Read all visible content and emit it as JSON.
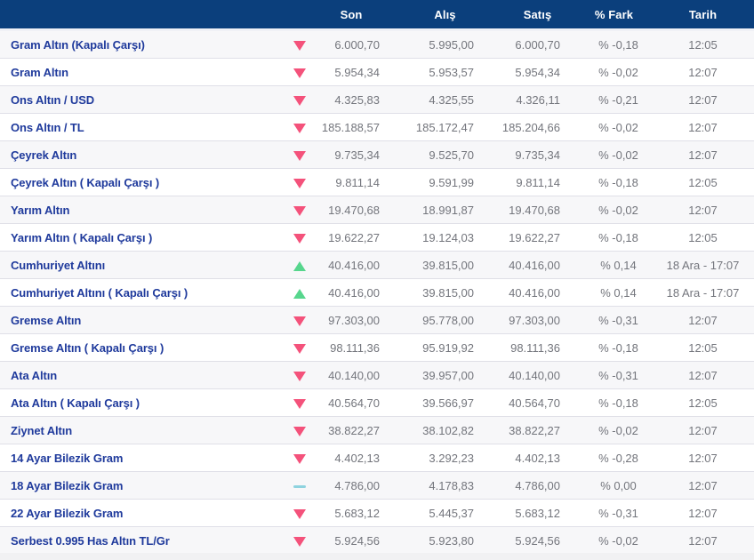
{
  "table": {
    "columns": [
      "Son",
      "Alış",
      "Satış",
      "% Fark",
      "Tarih"
    ],
    "rows": [
      {
        "name": "Gram Altın (Kapalı Çarşı)",
        "direction": "down",
        "son": "6.000,70",
        "alis": "5.995,00",
        "satis": "6.000,70",
        "fark": "% -0,18",
        "tarih": "12:05"
      },
      {
        "name": "Gram Altın",
        "direction": "down",
        "son": "5.954,34",
        "alis": "5.953,57",
        "satis": "5.954,34",
        "fark": "% -0,02",
        "tarih": "12:07"
      },
      {
        "name": "Ons Altın / USD",
        "direction": "down",
        "son": "4.325,83",
        "alis": "4.325,55",
        "satis": "4.326,11",
        "fark": "% -0,21",
        "tarih": "12:07"
      },
      {
        "name": "Ons Altın / TL",
        "direction": "down",
        "son": "185.188,57",
        "alis": "185.172,47",
        "satis": "185.204,66",
        "fark": "% -0,02",
        "tarih": "12:07"
      },
      {
        "name": "Çeyrek Altın",
        "direction": "down",
        "son": "9.735,34",
        "alis": "9.525,70",
        "satis": "9.735,34",
        "fark": "% -0,02",
        "tarih": "12:07"
      },
      {
        "name": "Çeyrek Altın ( Kapalı Çarşı )",
        "direction": "down",
        "son": "9.811,14",
        "alis": "9.591,99",
        "satis": "9.811,14",
        "fark": "% -0,18",
        "tarih": "12:05"
      },
      {
        "name": "Yarım Altın",
        "direction": "down",
        "son": "19.470,68",
        "alis": "18.991,87",
        "satis": "19.470,68",
        "fark": "% -0,02",
        "tarih": "12:07"
      },
      {
        "name": "Yarım Altın ( Kapalı Çarşı )",
        "direction": "down",
        "son": "19.622,27",
        "alis": "19.124,03",
        "satis": "19.622,27",
        "fark": "% -0,18",
        "tarih": "12:05"
      },
      {
        "name": "Cumhuriyet Altını",
        "direction": "up",
        "son": "40.416,00",
        "alis": "39.815,00",
        "satis": "40.416,00",
        "fark": "% 0,14",
        "tarih": "18 Ara - 17:07"
      },
      {
        "name": "Cumhuriyet Altını ( Kapalı Çarşı )",
        "direction": "up",
        "son": "40.416,00",
        "alis": "39.815,00",
        "satis": "40.416,00",
        "fark": "% 0,14",
        "tarih": "18 Ara - 17:07"
      },
      {
        "name": "Gremse Altın",
        "direction": "down",
        "son": "97.303,00",
        "alis": "95.778,00",
        "satis": "97.303,00",
        "fark": "% -0,31",
        "tarih": "12:07"
      },
      {
        "name": "Gremse Altın ( Kapalı Çarşı )",
        "direction": "down",
        "son": "98.111,36",
        "alis": "95.919,92",
        "satis": "98.111,36",
        "fark": "% -0,18",
        "tarih": "12:05"
      },
      {
        "name": "Ata Altın",
        "direction": "down",
        "son": "40.140,00",
        "alis": "39.957,00",
        "satis": "40.140,00",
        "fark": "% -0,31",
        "tarih": "12:07"
      },
      {
        "name": "Ata Altın ( Kapalı Çarşı )",
        "direction": "down",
        "son": "40.564,70",
        "alis": "39.566,97",
        "satis": "40.564,70",
        "fark": "% -0,18",
        "tarih": "12:05"
      },
      {
        "name": "Ziynet Altın",
        "direction": "down",
        "son": "38.822,27",
        "alis": "38.102,82",
        "satis": "38.822,27",
        "fark": "% -0,02",
        "tarih": "12:07"
      },
      {
        "name": "14 Ayar Bilezik Gram",
        "direction": "down",
        "son": "4.402,13",
        "alis": "3.292,23",
        "satis": "4.402,13",
        "fark": "% -0,28",
        "tarih": "12:07"
      },
      {
        "name": "18 Ayar Bilezik Gram",
        "direction": "flat",
        "son": "4.786,00",
        "alis": "4.178,83",
        "satis": "4.786,00",
        "fark": "% 0,00",
        "tarih": "12:07"
      },
      {
        "name": "22 Ayar Bilezik Gram",
        "direction": "down",
        "son": "5.683,12",
        "alis": "5.445,37",
        "satis": "5.683,12",
        "fark": "% -0,31",
        "tarih": "12:07"
      },
      {
        "name": "Serbest 0.995 Has Altın TL/Gr",
        "direction": "down",
        "son": "5.924,56",
        "alis": "5.923,80",
        "satis": "5.924,56",
        "fark": "% -0,02",
        "tarih": "12:07"
      }
    ]
  },
  "colors": {
    "header_bg": "#0b3f7c",
    "header_text": "#ffffff",
    "label_blue": "#1f3a9c",
    "value_gray": "#73757c",
    "down": "#f4527b",
    "up": "#57d68d",
    "flat": "#8ed3df",
    "row_shaded": "#f7f7f9",
    "row_border": "#dfdfe7"
  }
}
